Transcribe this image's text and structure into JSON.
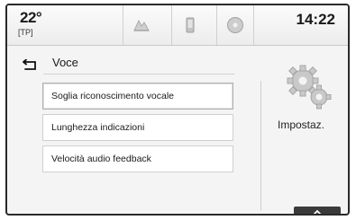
{
  "status_bar": {
    "temperature": "22°",
    "traffic_program": "[TP]",
    "tabs": [
      {
        "icon": "map-icon"
      },
      {
        "icon": "phone-icon"
      },
      {
        "icon": "media-icon"
      }
    ],
    "time": "14:22"
  },
  "page": {
    "title": "Voce",
    "back_icon": "back-arrow-icon"
  },
  "menu": {
    "items": [
      {
        "label": "Soglia riconoscimento vocale",
        "selected": true
      },
      {
        "label": "Lunghezza indicazioni",
        "selected": false
      },
      {
        "label": "Velocità audio feedback",
        "selected": false
      }
    ]
  },
  "side_panel": {
    "icon": "gears-icon",
    "label": "Impostaz."
  },
  "scroll": {
    "icon": "chevron-up-icon"
  }
}
